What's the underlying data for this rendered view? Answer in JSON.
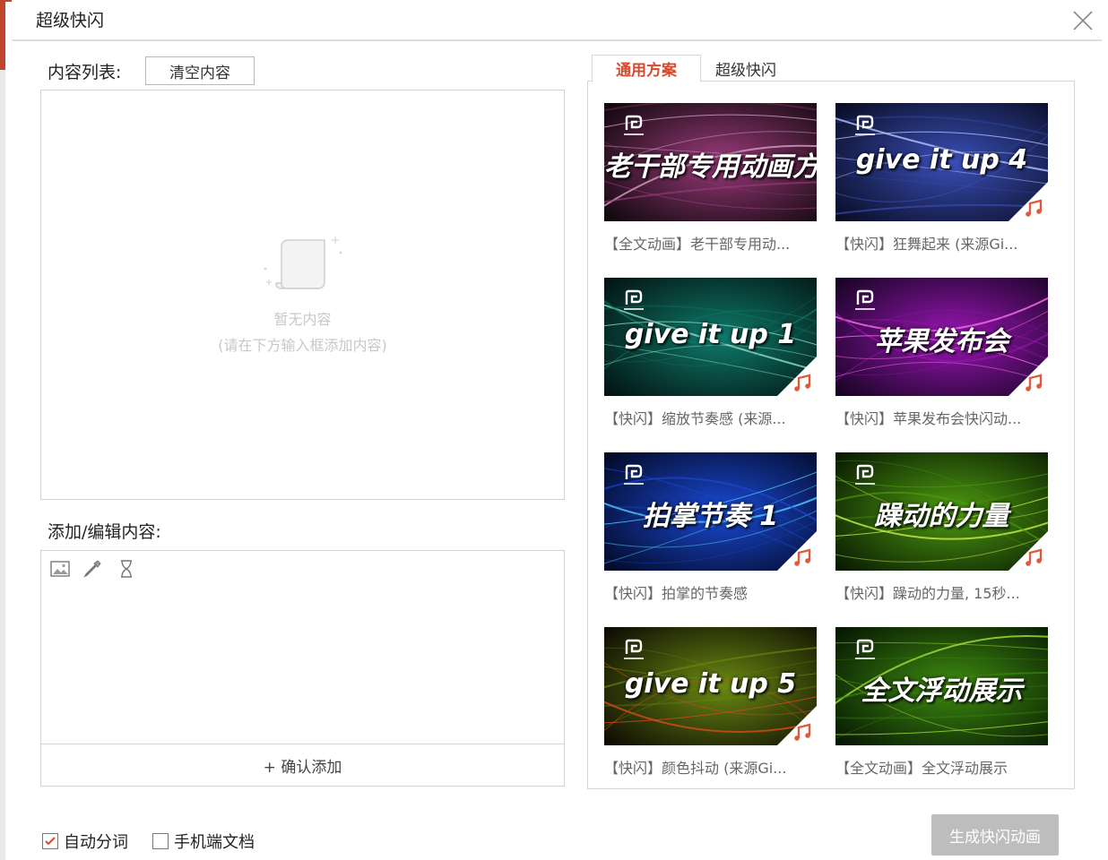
{
  "dialog": {
    "title": "超级快闪"
  },
  "content_list": {
    "label": "内容列表:",
    "clear_button": "清空内容",
    "empty_title": "暂无内容",
    "empty_hint": "(请在下方输入框添加内容)"
  },
  "editor": {
    "label": "添加/编辑内容:",
    "tools": [
      "image-icon",
      "eyedropper-icon",
      "hourglass-icon"
    ],
    "confirm_button": "+ 确认添加"
  },
  "options": {
    "auto_segment": {
      "label": "自动分词",
      "checked": true
    },
    "mobile_doc": {
      "label": "手机端文档",
      "checked": false
    }
  },
  "tabs": [
    {
      "label": "通用方案",
      "active": true
    },
    {
      "label": "超级快闪",
      "active": false
    }
  ],
  "templates": [
    {
      "title": "老干部专用动画方案",
      "caption": "【全文动画】老干部专用动...",
      "music": false,
      "colors": [
        "#0a0608",
        "#9a3a7a",
        "#d4a0c0"
      ]
    },
    {
      "title": "give it up 4",
      "caption": "【快闪】狂舞起来 (来源Gi...",
      "music": true,
      "colors": [
        "#070a1e",
        "#3a4fb8",
        "#b7c6ff"
      ]
    },
    {
      "title": "give it up 1",
      "caption": "【快闪】缩放节奏感 (来源...",
      "music": true,
      "colors": [
        "#031010",
        "#0e7a6a",
        "#8ee0c8"
      ]
    },
    {
      "title": "苹果发布会",
      "caption": "【快闪】苹果发布会快闪动...",
      "music": true,
      "colors": [
        "#12031e",
        "#9a16b4",
        "#ff6ef0"
      ]
    },
    {
      "title": "拍掌节奏 1",
      "caption": "【快闪】拍掌的节奏感",
      "music": true,
      "colors": [
        "#02061e",
        "#1a4ad6",
        "#4fd0ff"
      ]
    },
    {
      "title": "躁动的力量",
      "caption": "【快闪】躁动的力量, 15秒...",
      "music": true,
      "colors": [
        "#061402",
        "#4e9c10",
        "#c8f04a"
      ]
    },
    {
      "title": "give it up 5",
      "caption": "【快闪】颜色抖动 (来源Gi...",
      "music": true,
      "colors": [
        "#0a0602",
        "#6a8a12",
        "#d84a1c"
      ]
    },
    {
      "title": "全文浮动展示",
      "caption": "【全文动画】全文浮动展示",
      "music": false,
      "colors": [
        "#041202",
        "#3e8c10",
        "#a6e03a"
      ]
    }
  ],
  "generate_button": "生成快闪动画",
  "accent_color": "#d6492e"
}
